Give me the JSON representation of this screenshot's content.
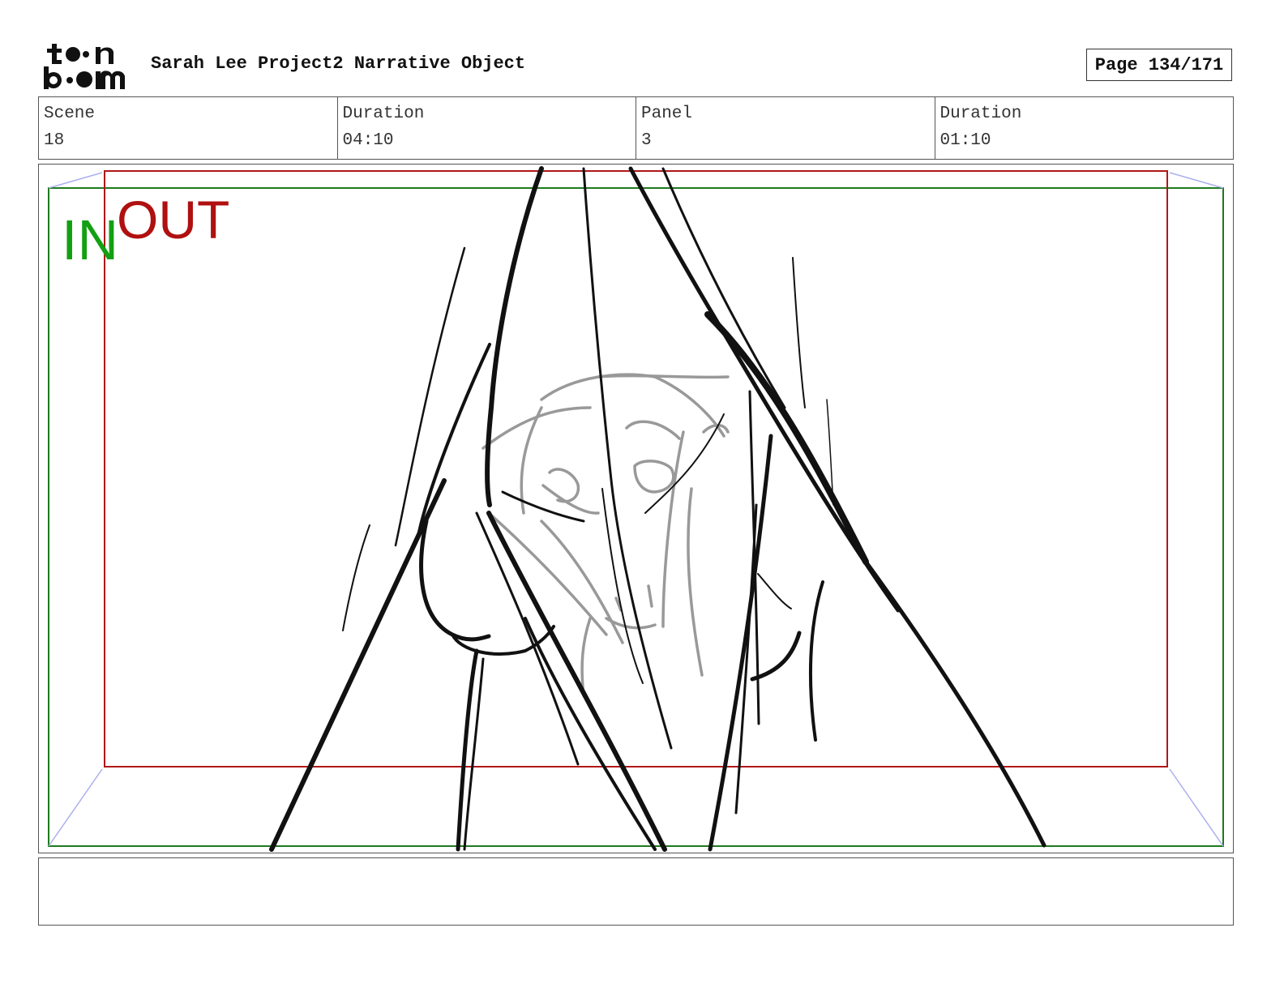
{
  "header": {
    "logo_text": "toon boom",
    "project_title": "Sarah Lee Project2 Narrative Object",
    "page_label": "Page 134/171"
  },
  "info": {
    "scene_label": "Scene",
    "scene_value": "18",
    "scene_duration_label": "Duration",
    "scene_duration_value": "04:10",
    "panel_label": "Panel",
    "panel_value": "3",
    "panel_duration_label": "Duration",
    "panel_duration_value": "01:10"
  },
  "panel": {
    "in_label": "IN",
    "out_label": "OUT",
    "in_color": "#12a012",
    "out_color": "#b01010"
  },
  "caption": {
    "text": ""
  }
}
